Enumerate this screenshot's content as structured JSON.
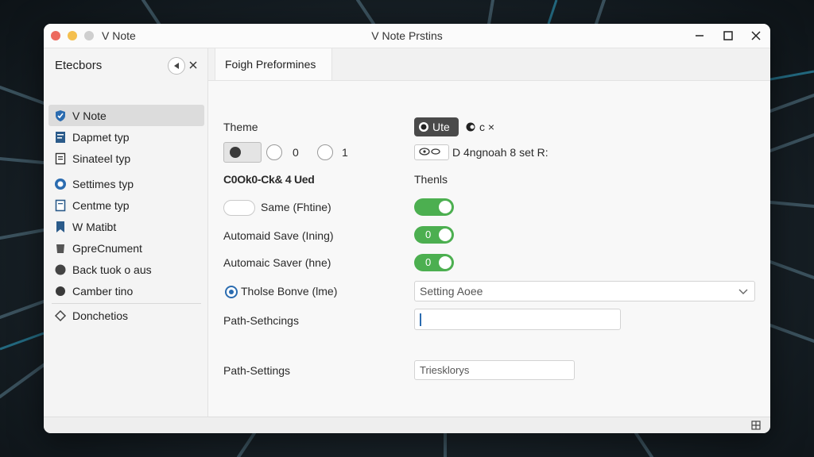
{
  "window": {
    "app_name": "V Note",
    "title": "V Note Prstins"
  },
  "sidebar": {
    "title": "Etecbors",
    "items": [
      {
        "label": "V Note",
        "icon": "check-shield-icon",
        "active": true
      },
      {
        "label": "Dapmet typ",
        "icon": "document-icon"
      },
      {
        "label": "Sinateel typ",
        "icon": "page-icon"
      },
      {
        "label": "Settimes typ",
        "icon": "settings-circle-icon"
      },
      {
        "label": "Centme typ",
        "icon": "file-icon"
      },
      {
        "label": "W Matibt",
        "icon": "bookmark-icon"
      },
      {
        "label": "GpreCnument",
        "icon": "cup-icon"
      },
      {
        "label": "Back tuok o aus",
        "icon": "circle-icon"
      },
      {
        "label": "Camber tino",
        "icon": "dot-icon"
      },
      {
        "label": "Donchetios",
        "icon": "diamond-icon"
      }
    ]
  },
  "tab": {
    "label": "Foigh Preformines"
  },
  "settings": {
    "theme_label": "Theme",
    "theme_dark_btn": "Ute",
    "theme_extra": "c ×",
    "radio_a": "0",
    "radio_b": "1",
    "font_value": "D 4ngnoah 8 set R:",
    "row3_label": "C0Ok0-Ck& 4 Ued",
    "row3_right": "Thenls",
    "same_label": "Same (Fhtine)",
    "auto1_label": "Automaid Save (Ining)",
    "auto1_toggle": "0",
    "auto2_label": "Automaic Saver (hne)",
    "auto2_toggle": "0",
    "tholse_label": "Tholse Bonve (lme)",
    "select_value": "Setting Aoee",
    "path1_label": "Path-Sethcings",
    "path2_label": "Path-Settings",
    "path2_value": "Triesklorys"
  },
  "colors": {
    "toggle_on": "#4caf50",
    "accent": "#2b6cb0",
    "active_item": "#dcdcdc"
  }
}
